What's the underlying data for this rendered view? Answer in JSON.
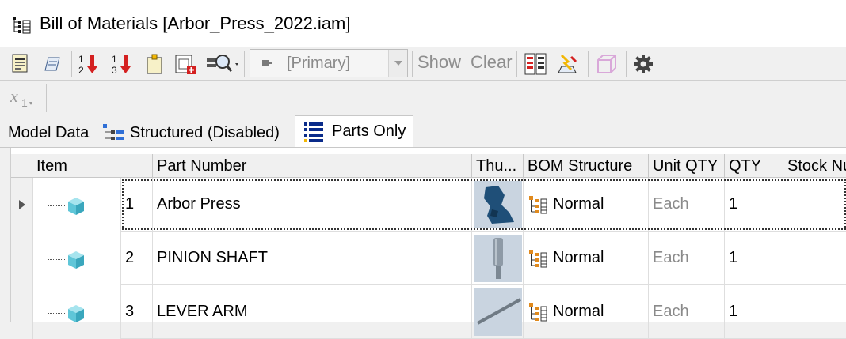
{
  "window": {
    "title": "Bill of Materials [Arbor_Press_2022.iam]"
  },
  "toolbar": {
    "buttons": [
      {
        "name": "export-bom-icon"
      },
      {
        "name": "edit-icon"
      },
      {
        "name": "sort-ascending-icon",
        "text": "2"
      },
      {
        "name": "renumber-items-icon",
        "text": "3"
      },
      {
        "name": "add-custom-part-icon"
      },
      {
        "name": "custom-part-icon"
      },
      {
        "name": "find-icon"
      }
    ],
    "view_combo": {
      "value": "[Primary]"
    },
    "show_label": "Show",
    "clear_label": "Clear",
    "right_buttons": [
      {
        "name": "bom-settings-icon"
      },
      {
        "name": "update-mass-icon"
      },
      {
        "name": "zoom-selection-icon"
      },
      {
        "name": "gear-icon"
      }
    ]
  },
  "formula_bar": {
    "button": "formula-icon",
    "value": ""
  },
  "tabs": [
    {
      "label": "Model Data"
    },
    {
      "label": "Structured (Disabled)"
    },
    {
      "label": "Parts Only"
    }
  ],
  "table": {
    "columns": [
      "Item",
      "Part Number",
      "Thu...",
      "BOM Structure",
      "Unit QTY",
      "QTY",
      "Stock Nu"
    ],
    "rows": [
      {
        "item": "1",
        "part_number": "Arbor Press",
        "bom_structure": "Normal",
        "unit_qty": "Each",
        "qty": "1"
      },
      {
        "item": "2",
        "part_number": "PINION SHAFT",
        "bom_structure": "Normal",
        "unit_qty": "Each",
        "qty": "1"
      },
      {
        "item": "3",
        "part_number": "LEVER ARM",
        "bom_structure": "Normal",
        "unit_qty": "Each",
        "qty": "1"
      }
    ]
  },
  "colors": {
    "part_cube": "#5fc6d8",
    "thumb_bg": "#c9d4e0",
    "bom_icon": "#e08a1e",
    "accent": "#0a2b8a"
  }
}
